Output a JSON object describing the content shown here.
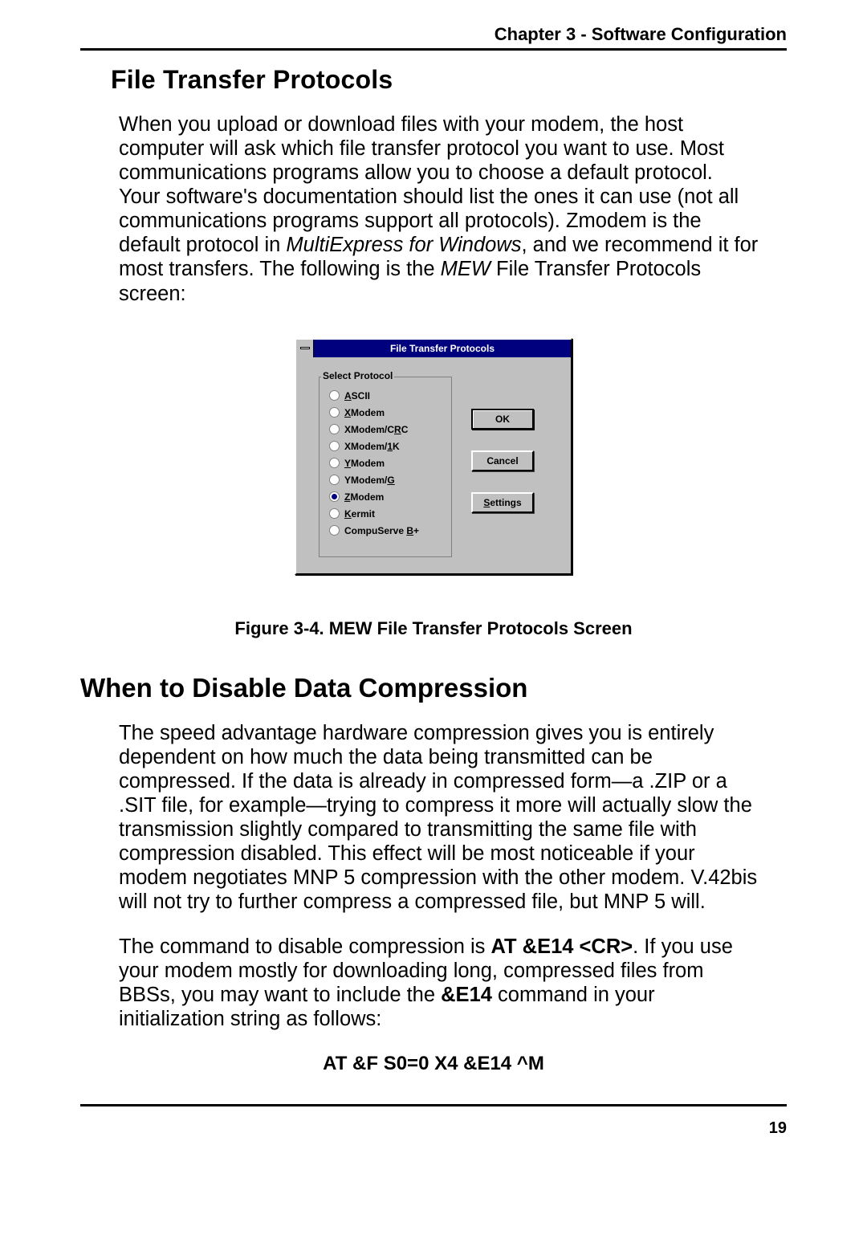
{
  "header": {
    "chapter_label": "Chapter 3 - Software Configuration"
  },
  "section1": {
    "title": "File Transfer Protocols",
    "para1_a": "When you upload or download files with your modem, the host computer will ask which file transfer protocol you want to use. Most communications programs allow you to choose a default protocol. Your software's documentation should list the ones it can use (not all communications programs support all protocols). Zmodem is the default protocol in ",
    "para1_b_italic": "MultiExpress for Windows",
    "para1_c": ", and we recommend it for most transfers.  The following is the ",
    "para1_d_italic": "MEW",
    "para1_e": " File Transfer Protocols screen:"
  },
  "dialog": {
    "title": "File Transfer Protocols",
    "group_legend": "Select Protocol",
    "options": [
      {
        "pre": "",
        "u": "A",
        "post": "SCII",
        "selected": false
      },
      {
        "pre": "",
        "u": "X",
        "post": "Modem",
        "selected": false
      },
      {
        "pre": "XModem/C",
        "u": "R",
        "post": "C",
        "selected": false
      },
      {
        "pre": "XModem/",
        "u": "1",
        "post": "K",
        "selected": false
      },
      {
        "pre": "",
        "u": "Y",
        "post": "Modem",
        "selected": false
      },
      {
        "pre": "YModem/",
        "u": "G",
        "post": "",
        "selected": false
      },
      {
        "pre": "",
        "u": "Z",
        "post": "Modem",
        "selected": true
      },
      {
        "pre": "",
        "u": "K",
        "post": "ermit",
        "selected": false
      },
      {
        "pre": "CompuServe ",
        "u": "B",
        "post": "+",
        "selected": false
      }
    ],
    "buttons": {
      "ok": "OK",
      "cancel": "Cancel",
      "settings_u": "S",
      "settings_rest": "ettings"
    }
  },
  "figure_caption": "Figure 3-4. MEW File Transfer Protocols Screen",
  "section2": {
    "title": "When to Disable Data Compression",
    "para1": "The speed advantage hardware compression gives you is entirely dependent on how much the data being transmitted can be compressed. If the data is already in compressed form—a .ZIP or a .SIT file, for example—trying to compress it more will actually slow the transmission slightly compared to transmitting the same file with compression disabled. This effect will be most noticeable if your modem negotiates MNP 5 compression with the other modem. V.42bis will not try to further compress a compressed file, but MNP 5 will.",
    "para2_a": "The command to disable compression is ",
    "para2_b_bold": "AT &E14 <CR>",
    "para2_c": ". If you use your modem mostly for downloading long, compressed files from BBSs, you may want to include the ",
    "para2_d_bold": "&E14",
    "para2_e": " command in your initialization string as follows:",
    "init_string": "AT &F S0=0 X4 &E14 ^M"
  },
  "footer": {
    "page_number": "19"
  }
}
